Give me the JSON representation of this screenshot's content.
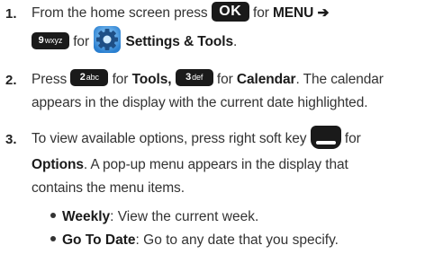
{
  "steps": [
    {
      "number": "1.",
      "line1_text": "From the home screen press",
      "ok_key": "OK",
      "line1_for": "for",
      "menu_label": "MENU",
      "arrow": "➔",
      "key9_digit": "9",
      "key9_letters": "wxyz",
      "line2_for": "for",
      "settings_label": "Settings & Tools",
      "line2_end": "."
    },
    {
      "number": "2.",
      "press": "Press",
      "key2_digit": "2",
      "key2_letters": "abc",
      "for1": "for",
      "tools_label": "Tools,",
      "key3_digit": "3",
      "key3_letters": "def",
      "for2": "for",
      "calendar_label": "Calendar",
      "line1_rest": ". The calendar",
      "line2": "appears in the display with the current date highlighted."
    },
    {
      "number": "3.",
      "line1": "To view available options, press right soft key",
      "for": "for",
      "options_label": "Options",
      "line2_rest": ". A pop-up menu appears in the display that",
      "line3": "contains the menu items."
    }
  ],
  "bullets": [
    {
      "term": "Weekly",
      "desc": ": View the current week."
    },
    {
      "term": "Go To Date",
      "desc": ": Go to any date that you specify."
    }
  ]
}
